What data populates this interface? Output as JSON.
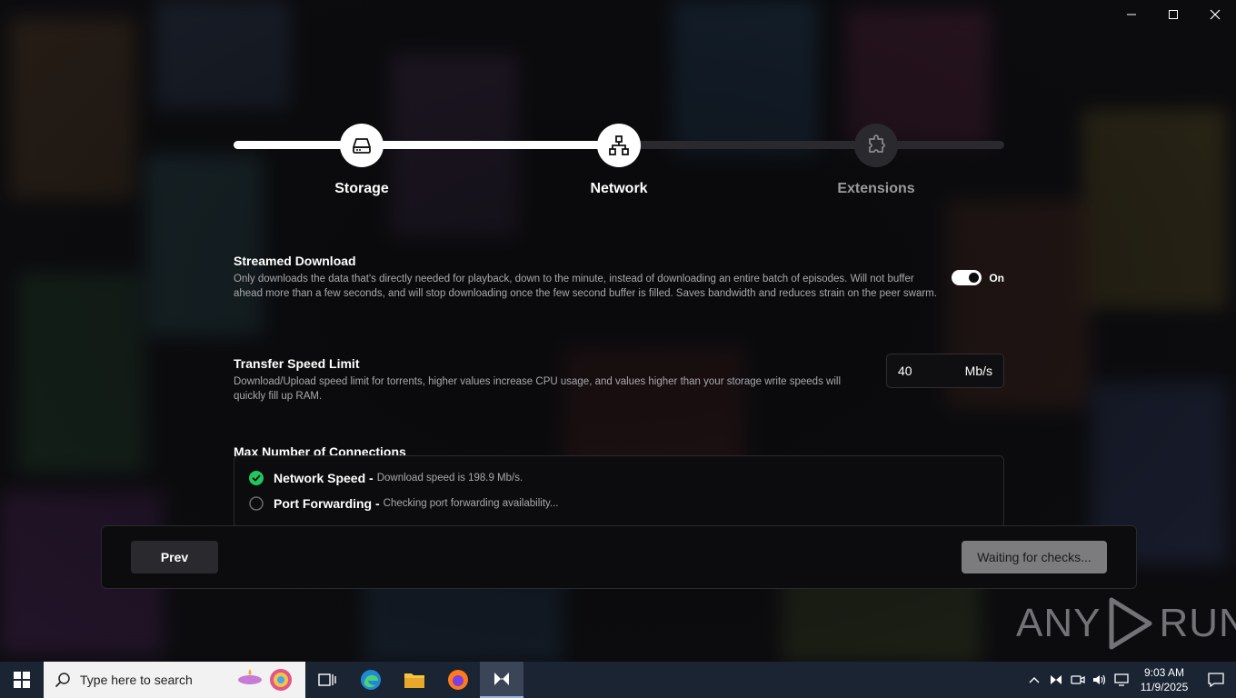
{
  "stepper": {
    "steps": [
      {
        "label": "Storage",
        "icon": "hard-drive-icon",
        "state": "done"
      },
      {
        "label": "Network",
        "icon": "network-icon",
        "state": "active"
      },
      {
        "label": "Extensions",
        "icon": "puzzle-icon",
        "state": "todo"
      }
    ],
    "progress": 0.5
  },
  "settings": {
    "streamed_download": {
      "title": "Streamed Download",
      "description": "Only downloads the data that's directly needed for playback, down to the minute, instead of downloading an entire batch of episodes. Will not buffer ahead more than a few seconds, and will stop downloading once the few second buffer is filled. Saves bandwidth and reduces strain on the peer swarm.",
      "toggle_label": "On",
      "enabled": true
    },
    "transfer_speed_limit": {
      "title": "Transfer Speed Limit",
      "description": "Download/Upload speed limit for torrents, higher values increase CPU usage, and values higher than your storage write speeds will quickly fill up RAM.",
      "value": "40",
      "unit": "Mb/s"
    },
    "max_connections": {
      "title": "Max Number of Connections"
    }
  },
  "checks": [
    {
      "name": "Network Speed -",
      "detail": "Download speed is 198.9 Mb/s.",
      "status": "passed"
    },
    {
      "name": "Port Forwarding -",
      "detail": "Checking port forwarding availability...",
      "status": "pending"
    }
  ],
  "footer": {
    "prev_label": "Prev",
    "next_label": "Waiting for checks..."
  },
  "watermark": {
    "text_left": "ANY",
    "text_right": "RUN"
  },
  "taskbar": {
    "search_placeholder": "Type here to search",
    "time": "9:03 AM",
    "date": "11/9/2025"
  },
  "colors": {
    "accent_white": "#ffffff",
    "check_green": "#22c55e",
    "track_inactive": "#2a2a2e",
    "button_disabled": "#7c7c7e",
    "taskbar": "#1b2433"
  }
}
